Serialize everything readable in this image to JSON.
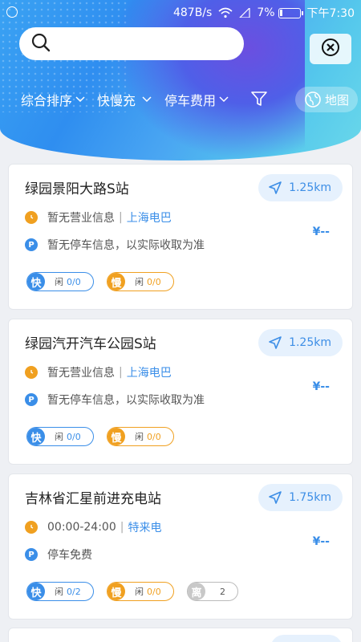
{
  "status": {
    "speed": "487B/s",
    "battery": "7%",
    "time": "下午7:30"
  },
  "search": {
    "placeholder": ""
  },
  "filters": {
    "sort": "综合排序",
    "speed_type": "快慢充",
    "parking_fee": "停车费用",
    "map": "地图"
  },
  "stations": [
    {
      "name": "绿园景阳大路S站",
      "distance": "1.25km",
      "hours": "暂无营业信息",
      "operator": "上海电巴",
      "parking": "暂无停车信息，以实际收取为准",
      "price": "¥--",
      "fast": {
        "tag": "快",
        "label": "闲",
        "value": "0/0"
      },
      "slow": {
        "tag": "慢",
        "label": "闲",
        "value": "0/0"
      }
    },
    {
      "name": "绿园汽开汽车公园S站",
      "distance": "1.25km",
      "hours": "暂无营业信息",
      "operator": "上海电巴",
      "parking": "暂无停车信息，以实际收取为准",
      "price": "¥--",
      "fast": {
        "tag": "快",
        "label": "闲",
        "value": "0/0"
      },
      "slow": {
        "tag": "慢",
        "label": "闲",
        "value": "0/0"
      }
    },
    {
      "name": "吉林省汇星前进充电站",
      "distance": "1.75km",
      "hours": "00:00-24:00",
      "operator": "特来电",
      "parking": "停车免费",
      "price": "¥--",
      "fast": {
        "tag": "快",
        "label": "闲",
        "value": "0/2"
      },
      "slow": {
        "tag": "慢",
        "label": "闲",
        "value": "0/0"
      },
      "away": {
        "tag": "离",
        "value": "2"
      }
    }
  ],
  "colors": {
    "accent": "#3a8ee8",
    "slow": "#f0a020"
  }
}
